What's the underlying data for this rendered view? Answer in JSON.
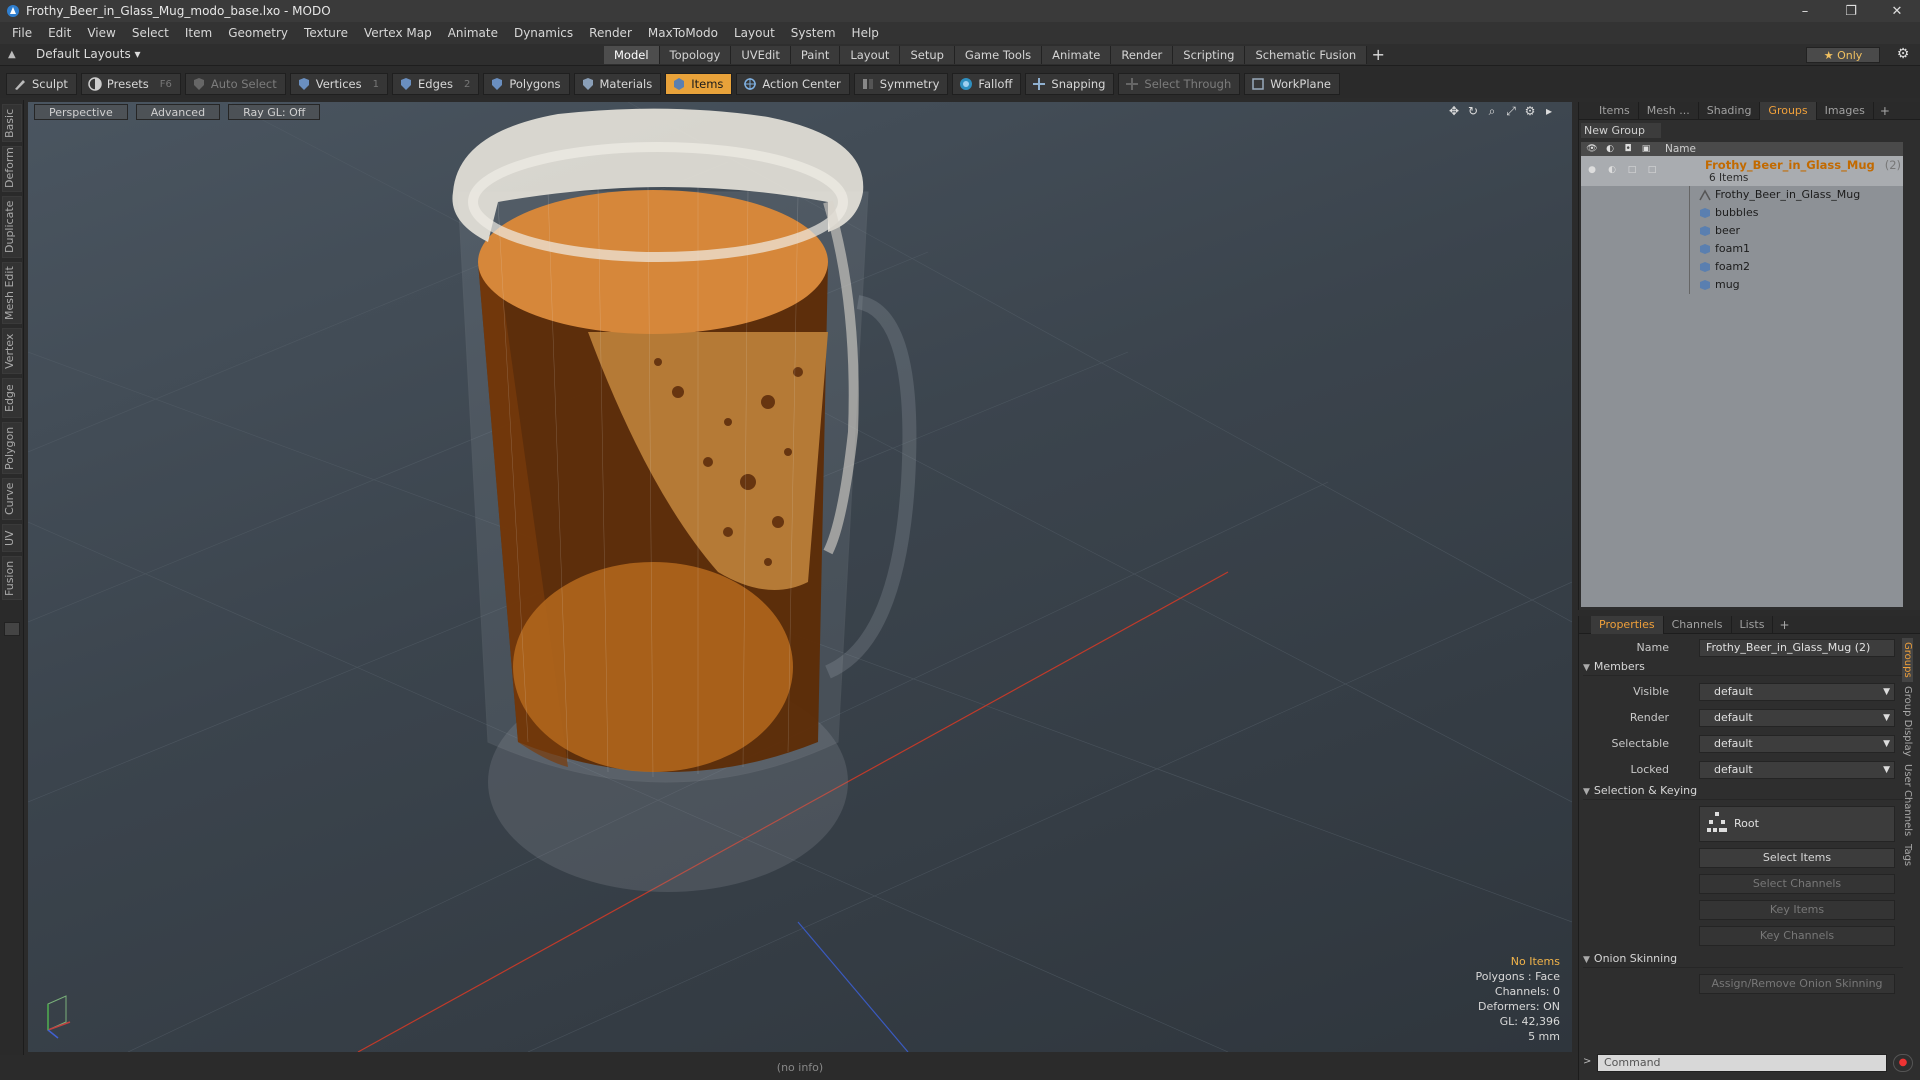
{
  "window": {
    "title": "Frothy_Beer_in_Glass_Mug_modo_base.lxo - MODO",
    "buttons": [
      "–",
      "❐",
      "✕"
    ]
  },
  "menu": [
    "File",
    "Edit",
    "View",
    "Select",
    "Item",
    "Geometry",
    "Texture",
    "Vertex Map",
    "Animate",
    "Dynamics",
    "Render",
    "MaxToModo",
    "Layout",
    "System",
    "Help"
  ],
  "layout": {
    "selector": "Default Layouts ▾",
    "tabs": [
      "Model",
      "Topology",
      "UVEdit",
      "Paint",
      "Layout",
      "Setup",
      "Game Tools",
      "Animate",
      "Render",
      "Scripting",
      "Schematic Fusion"
    ],
    "active_tab": "Model",
    "only_label": "★ Only"
  },
  "toolbar": {
    "sculpt": "Sculpt",
    "presets": "Presets",
    "presets_hotkey": "F6",
    "auto_select": "Auto Select",
    "vertices": "Vertices",
    "vertices_hotkey": "1",
    "edges": "Edges",
    "edges_hotkey": "2",
    "polygons": "Polygons",
    "materials": "Materials",
    "items": "Items",
    "action_center": "Action Center",
    "symmetry": "Symmetry",
    "falloff": "Falloff",
    "snapping": "Snapping",
    "select_through": "Select Through",
    "workplane": "WorkPlane"
  },
  "left_tabs": [
    "Basic",
    "Deform",
    "Duplicate",
    "Mesh Edit",
    "Vertex",
    "Edge",
    "Polygon",
    "Curve",
    "UV",
    "Fusion"
  ],
  "viewport": {
    "view": "Perspective",
    "shading": "Advanced",
    "raygl": "Ray GL: Off",
    "stats": {
      "selection": "No Items",
      "polygons": "Polygons : Face",
      "channels": "Channels: 0",
      "deformers": "Deformers: ON",
      "gl": "GL: 42,396",
      "scale": "5 mm"
    }
  },
  "status_bar": "(no info)",
  "groups_panel": {
    "tabs": [
      "Items",
      "Mesh ...",
      "Shading",
      "Groups",
      "Images"
    ],
    "active_tab": "Groups",
    "new_group": "New Group",
    "column_name": "Name",
    "root": {
      "name": "Frothy_Beer_in_Glass_Mug",
      "suffix": "(2)",
      "count": "6 Items"
    },
    "items": [
      "Frothy_Beer_in_Glass_Mug",
      "bubbles",
      "beer",
      "foam1",
      "foam2",
      "mug"
    ]
  },
  "properties": {
    "tabs": [
      "Properties",
      "Channels",
      "Lists"
    ],
    "active_tab": "Properties",
    "name_label": "Name",
    "name_value": "Frothy_Beer_in_Glass_Mug (2)",
    "members_section": "Members",
    "visible_label": "Visible",
    "visible_value": "default",
    "render_label": "Render",
    "render_value": "default",
    "selectable_label": "Selectable",
    "selectable_value": "default",
    "locked_label": "Locked",
    "locked_value": "default",
    "selection_section": "Selection & Keying",
    "root_button": "Root",
    "select_items": "Select Items",
    "select_channels": "Select Channels",
    "key_items": "Key Items",
    "key_channels": "Key Channels",
    "onion_section": "Onion Skinning",
    "assign_onion": "Assign/Remove Onion Skinning",
    "side_tabs": [
      "Groups",
      "Group Display",
      "User Channels",
      "Tags"
    ],
    "command_placeholder": "Command"
  },
  "colors": {
    "accent": "#e8a23a",
    "beer": "#8a4a10",
    "foam": "#e6e2da"
  }
}
